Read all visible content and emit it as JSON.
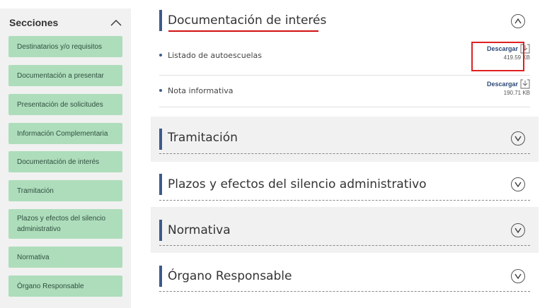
{
  "sidebar": {
    "title": "Secciones",
    "items": [
      {
        "label": "Destinatarios y/o requisitos"
      },
      {
        "label": "Documentación a presentar"
      },
      {
        "label": "Presentación de solicitudes"
      },
      {
        "label": "Información Complementaria"
      },
      {
        "label": "Documentación de interés"
      },
      {
        "label": "Tramitación"
      },
      {
        "label": "Plazos y efectos del silencio administrativo"
      },
      {
        "label": "Normativa"
      },
      {
        "label": "Órgano Responsable"
      }
    ]
  },
  "main": {
    "expanded_section": {
      "title": "Documentación de interés",
      "documents": [
        {
          "name": "Listado de autoescuelas",
          "download_label": "Descargar",
          "size": "419.59 KB"
        },
        {
          "name": "Nota informativa",
          "download_label": "Descargar",
          "size": "190.71 KB"
        }
      ]
    },
    "collapsed_sections": [
      {
        "title": "Tramitación"
      },
      {
        "title": "Plazos y efectos del silencio administrativo"
      },
      {
        "title": "Normativa"
      },
      {
        "title": "Órgano Responsable"
      }
    ]
  },
  "colors": {
    "accent_bar": "#3d5a8a",
    "sidebar_item_bg": "#aeddbb",
    "highlight_red": "#e02020"
  }
}
